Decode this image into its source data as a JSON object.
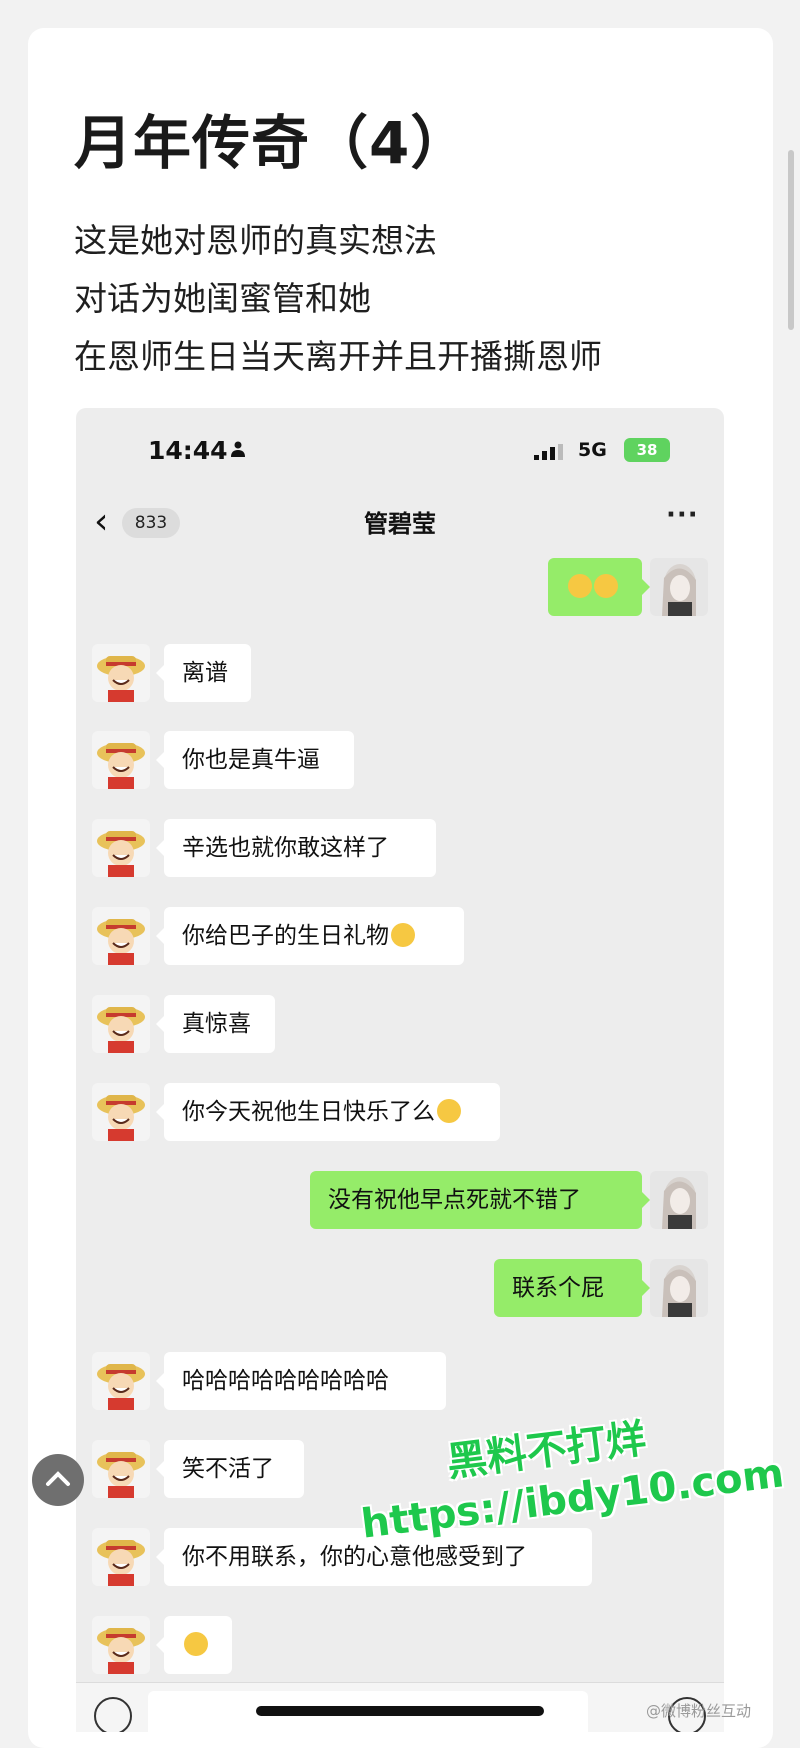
{
  "article": {
    "title": "月年传奇（4）",
    "lines": [
      "这是她对恩师的真实想法",
      "对话为她闺蜜管和她",
      "在恩师生日当天离开并且开播撕恩师"
    ]
  },
  "phone": {
    "time": "14:44",
    "network": "5G",
    "battery": "38"
  },
  "chat": {
    "unread_count": "833",
    "contact_name": "管碧莹",
    "more_label": "···",
    "messages": [
      {
        "side": "out",
        "text": "",
        "emoji": 2
      },
      {
        "side": "in",
        "text": "离谱"
      },
      {
        "side": "in",
        "text": "你也是真牛逼"
      },
      {
        "side": "in",
        "text": "辛选也就你敢这样了"
      },
      {
        "side": "in",
        "text": "你给巴子的生日礼物",
        "emoji": 1
      },
      {
        "side": "in",
        "text": "真惊喜"
      },
      {
        "side": "in",
        "text": "你今天祝他生日快乐了么",
        "emoji": 1
      },
      {
        "side": "out",
        "text": "没有祝他早点死就不错了"
      },
      {
        "side": "out",
        "text": "联系个屁"
      },
      {
        "side": "in",
        "text": "哈哈哈哈哈哈哈哈哈"
      },
      {
        "side": "in",
        "text": "笑不活了"
      },
      {
        "side": "in",
        "text": "你不用联系，你的心意他感受到了"
      },
      {
        "side": "in",
        "text": "",
        "emoji": 1
      }
    ]
  },
  "watermark": {
    "line1": "黑料不打烊",
    "line2": "https://ibdy10.com",
    "credit": "@微博粉丝互动"
  },
  "colors": {
    "bubble_out": "#95ec69",
    "bubble_in": "#ffffff",
    "chat_bg": "#ededed",
    "watermark": "#1ec84c"
  }
}
